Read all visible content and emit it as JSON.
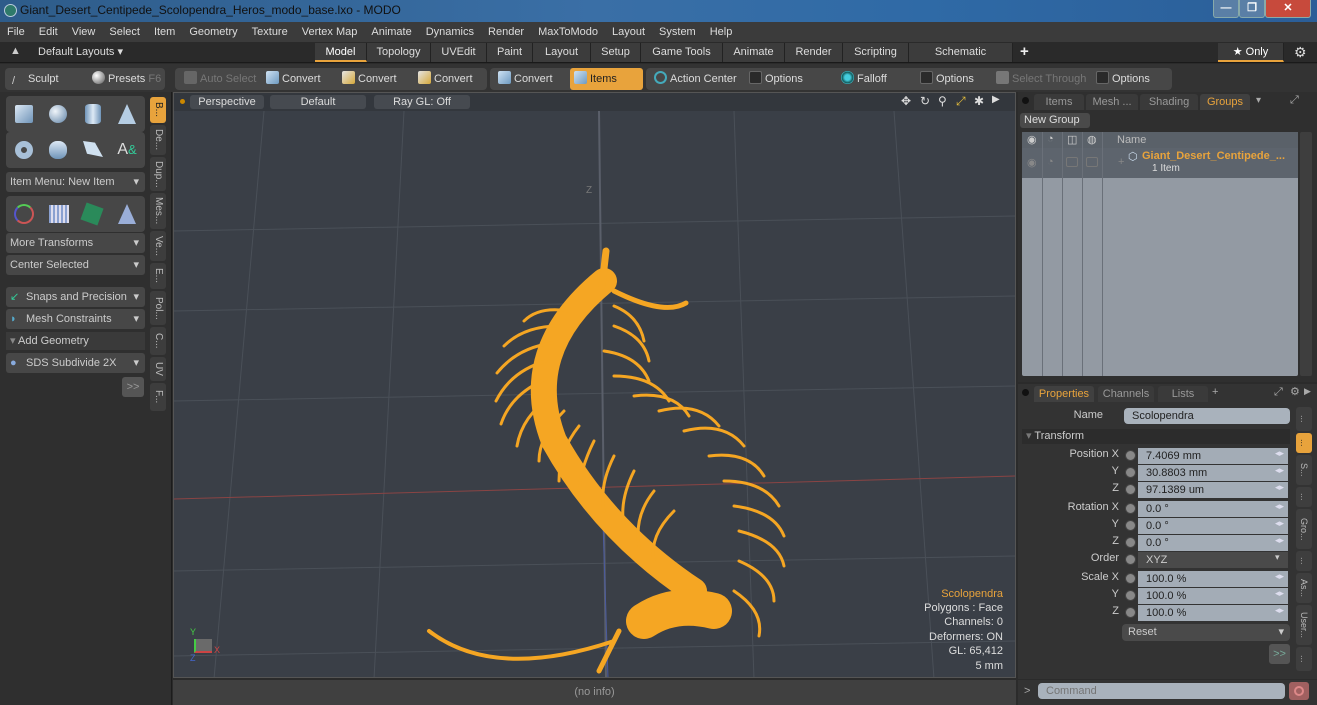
{
  "window": {
    "title": "Giant_Desert_Centipede_Scolopendra_Heros_modo_base.lxo - MODO",
    "controls": [
      "minimize",
      "maximize",
      "close"
    ]
  },
  "menu": [
    "File",
    "Edit",
    "View",
    "Select",
    "Item",
    "Geometry",
    "Texture",
    "Vertex Map",
    "Animate",
    "Dynamics",
    "Render",
    "MaxToModo",
    "Layout",
    "System",
    "Help"
  ],
  "layoutbar": {
    "layouts_label": "Default Layouts ▾",
    "tabs": [
      "Model",
      "Topology",
      "UVEdit",
      "Paint",
      "Layout",
      "Setup",
      "Game Tools",
      "Animate",
      "Render",
      "Scripting",
      "Schematic Fusion"
    ],
    "active_tab": "Model",
    "add_label": "+",
    "only_label": "★ Only"
  },
  "toolbar": {
    "sculpt": "Sculpt",
    "presets": "Presets",
    "presets_key": "F6",
    "auto_select": "Auto Select",
    "convert1": "Convert",
    "convert2": "Convert",
    "convert3": "Convert",
    "convert4": "Convert",
    "items": "Items",
    "action_center": "Action Center",
    "options1": "Options",
    "falloff": "Falloff",
    "options2": "Options",
    "select_through": "Select Through",
    "options3": "Options"
  },
  "leftpanel": {
    "item_menu": "Item Menu: New Item",
    "more_transforms": "More Transforms",
    "center_selected": "Center Selected",
    "snaps": "Snaps and Precision",
    "mesh_constraints": "Mesh Constraints",
    "add_geometry": "Add Geometry",
    "sds": "SDS Subdivide 2X",
    "more": ">>",
    "vtabs": [
      "B...",
      "De...",
      "Dup...",
      "Mes...",
      "Ve...",
      "E...",
      "Pol...",
      "C...",
      "UV",
      "F..."
    ]
  },
  "viewport": {
    "view": "Perspective",
    "shading": "Default",
    "raygl": "Ray GL: Off",
    "axis_label": "Z",
    "hud": {
      "name": "Scolopendra",
      "polygons": "Polygons : Face",
      "channels": "Channels: 0",
      "deformers": "Deformers: ON",
      "gl": "GL: 65,412",
      "unit": "5 mm"
    },
    "info": "(no info)"
  },
  "groups": {
    "tabs": [
      "Items",
      "Mesh ...",
      "Shading",
      "Groups"
    ],
    "active_tab": "Groups",
    "new_group": "New Group",
    "col_name": "Name",
    "rows": [
      {
        "name": "Giant_Desert_Centipede_...",
        "sub": "1 Item"
      }
    ]
  },
  "props": {
    "tabs": [
      "Properties",
      "Channels",
      "Lists"
    ],
    "active_tab": "Properties",
    "name_label": "Name",
    "name_value": "Scolopendra",
    "section": "Transform",
    "rows": [
      {
        "label": "Position X",
        "value": "7.4069 mm"
      },
      {
        "label": "Y",
        "value": "30.8803 mm"
      },
      {
        "label": "Z",
        "value": "97.1389 um"
      },
      {
        "label": "Rotation X",
        "value": "0.0 °"
      },
      {
        "label": "Y",
        "value": "0.0 °"
      },
      {
        "label": "Z",
        "value": "0.0 °"
      },
      {
        "label": "Order",
        "value": "XYZ"
      },
      {
        "label": "Scale X",
        "value": "100.0 %"
      },
      {
        "label": "Y",
        "value": "100.0 %"
      },
      {
        "label": "Z",
        "value": "100.0 %"
      }
    ],
    "reset": "Reset",
    "more": ">>",
    "side_tabs": [
      "...",
      "...",
      "S...",
      "...",
      "Gro...",
      "...",
      "As...",
      "User...",
      "..."
    ]
  },
  "command": {
    "prompt": ">",
    "placeholder": "Command"
  },
  "colors": {
    "accent": "#e8a33c",
    "mesh": "#f5a623"
  }
}
